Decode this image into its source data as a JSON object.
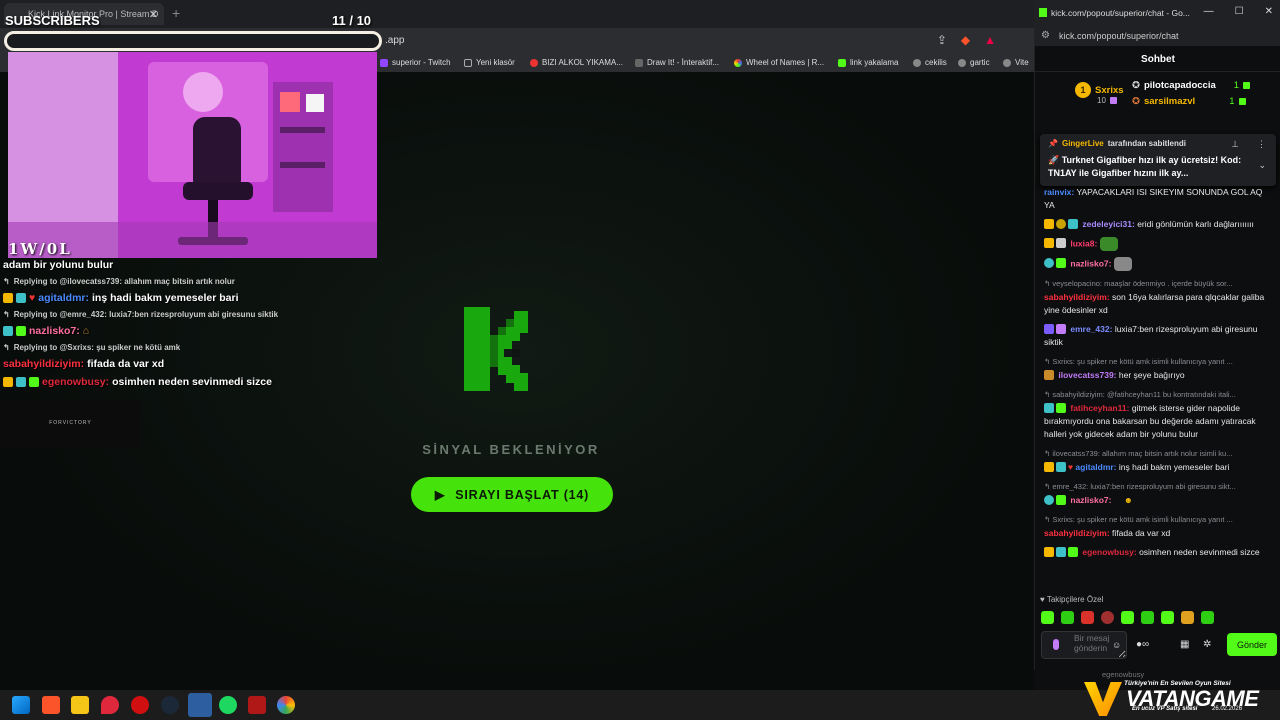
{
  "browser": {
    "tab_title": "Kick Link Monitor Pro | Stream D",
    "tab_close": "✕",
    "new_tab": "+",
    "address_suffix": ".app",
    "bookmarks": [
      {
        "label": "superior - Twitch",
        "color": "#9146ff"
      },
      {
        "label": "Yeni klasör",
        "color": "#444"
      },
      {
        "label": "BIZI ALKOL YIKAMA...",
        "color": "#e33"
      },
      {
        "label": "Draw It! - İnteraktif...",
        "color": "#666"
      },
      {
        "label": "Wheel of Names | R...",
        "color": "#3a6ee8"
      },
      {
        "label": "link yakalama",
        "color": "#53fc18"
      },
      {
        "label": "cekilis",
        "color": "#888"
      },
      {
        "label": "gartic",
        "color": "#888"
      },
      {
        "label": "Vite",
        "color": "#888"
      }
    ]
  },
  "monitor": {
    "status_text": "SİNYAL BEKLENİYOR",
    "start_button_label": "SIRAYI BAŞLAT (14)",
    "play_icon": "▶"
  },
  "overlay": {
    "subs_title": "SUBSCRIBERS",
    "subs_count": "11  / 10",
    "cam_logo": "1W/0L",
    "sponsor": "FORVICTORY",
    "chat": [
      {
        "type": "text",
        "text": "adam bir yolunu bulur"
      },
      {
        "type": "reply",
        "text": "Replying to @ilovecatss739: allahım maç bitsin artık nolur"
      },
      {
        "type": "msg",
        "user": "agitaldmr:",
        "user_color": "#4b8bff",
        "text": "inş hadi bakm yemeseler bari"
      },
      {
        "type": "reply",
        "text": "Replying to @emre_432: luxia7:ben rizesproluyum abi giresunu siktik"
      },
      {
        "type": "msg",
        "user": "nazlisko7:",
        "user_color": "#ff6fa0",
        "text": ""
      },
      {
        "type": "reply",
        "text": "Replying to @Sxrixs: şu spiker ne kötü amk"
      },
      {
        "type": "msg",
        "user": "sabahyildiziyim:",
        "user_color": "#ff3040",
        "text": "fifada da var xd"
      },
      {
        "type": "msg",
        "user": "egenowbusy:",
        "user_color": "#e0283c",
        "text": "osimhen neden sevinmedi sizce"
      }
    ]
  },
  "chat_window": {
    "title": "kick.com/popout/superior/chat - Go...",
    "url": "kick.com/popout/superior/chat",
    "header": "Sohbet",
    "window_controls": [
      "—",
      "☐",
      "✕"
    ],
    "leaderboard": {
      "top_user": "Sxrixs",
      "top_count": "10",
      "rank": "1",
      "second_user": "pilotcapadoccia",
      "second_count": "1",
      "third_user": "sarsilmazvl",
      "third_count": "1"
    },
    "pinned": {
      "by_user": "GingerLive",
      "by_text": "tarafından sabitlendi",
      "message": "🚀 Turknet Gigafiber hızı ilk ay ücretsiz! Kod: TN1AY ile Gigafiber hızını ilk ay..."
    },
    "messages": [
      {
        "user": "rainvix:",
        "color": "#4b8bff",
        "text": "YAPACAKLARI ISI SIKEYIM SONUNDA GOL AQ YA",
        "reply": ""
      },
      {
        "user": "zedeleyici31:",
        "color": "#a98bff",
        "text": "eridi gönlümün karlı dağlarııııııı",
        "reply": ""
      },
      {
        "user": "luxia8:",
        "color": "#ff3b6b",
        "text": "",
        "reply": ""
      },
      {
        "user": "nazlisko7:",
        "color": "#ff6fa0",
        "text": "",
        "reply": ""
      },
      {
        "user": "sabahyildiziyim:",
        "color": "#ff3040",
        "text": "son 16ya kalırlarsa para qlqcaklar galiba yine ödesinler xd",
        "reply": "veyselopacino: maaşlar ödenmiyo . içerde büyük sor..."
      },
      {
        "user": "emre_432:",
        "color": "#7b8cff",
        "text": "luxia7:ben rizesproluyum abi giresunu siktik",
        "reply": ""
      },
      {
        "user": "ilovecatss739:",
        "color": "#c27cf7",
        "text": "her şeye bağırıyo",
        "reply": "Sxrixs: şu spiker ne kötü amk isimli kullanıcıya yanıt ..."
      },
      {
        "user": "fatihceyhan11:",
        "color": "#e0283c",
        "text": "gitmek isterse gider napolide bırakmıyordu ona bakarsan bu değerde adamı yatıracak halleri yok gidecek adam bir yolunu bulur",
        "reply": "sabahyildiziyim: @fatihceyhan11 bu kontratındaki itali..."
      },
      {
        "user": "agitaldmr:",
        "color": "#4b8bff",
        "text": "inş hadi bakm yemeseler bari",
        "reply": "ilovecatss739: allahım maç bitsin artık nolur isimli ku..."
      },
      {
        "user": "nazlisko7:",
        "color": "#ff6fa0",
        "text": "",
        "reply": "emre_432: luxia7:ben rizesproluyum abi giresunu sikt..."
      },
      {
        "user": "sabahyildiziyim:",
        "color": "#ff3040",
        "text": "fifada da var xd",
        "reply": "Sxrixs: şu spiker ne kötü amk isimli kullanıcıya yanıt ..."
      },
      {
        "user": "egenowbusy:",
        "color": "#e0283c",
        "text": "osimhen neden sevinmedi sizce",
        "reply": ""
      }
    ],
    "followers_label": "♥ Takipçilere Özel",
    "input_placeholder": "Bir mesaj gönderin",
    "send_label": "Gönder",
    "under_text": "egenowbusy"
  },
  "ads": {
    "line1": "Türkiye'nin En Sevilen Oyun Sitesi",
    "brand": "VATANGAME",
    "line2": "En ucuz VP Satış sitesi",
    "date": "26.02.2026",
    "brand_suffix": ".com"
  }
}
